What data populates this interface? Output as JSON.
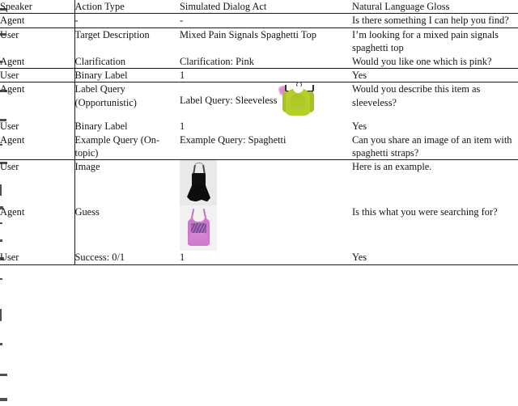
{
  "table": {
    "columns": [
      {
        "key": "speaker",
        "label": "Speaker"
      },
      {
        "key": "action",
        "label": "Action Type"
      },
      {
        "key": "dialog",
        "label": "Simulated Dialog Act"
      },
      {
        "key": "gloss",
        "label": "Natural Language Gloss"
      }
    ],
    "rows": [
      {
        "speaker": "Agent",
        "action": "-",
        "dialog": "-",
        "gloss": "Is there something I can help you find?",
        "media": null,
        "rule_above": false
      },
      {
        "speaker": "User",
        "action": "Target Description",
        "dialog": "Mixed Pain Signals Spaghetti Top",
        "gloss": "I’m looking for a mixed pain signals spaghetti top",
        "media": null,
        "rule_above": true
      },
      {
        "speaker": "Agent",
        "action": "Clarification",
        "dialog": "Clarification: Pink",
        "gloss": "Would you like one which is pink?",
        "media": null,
        "rule_above": false
      },
      {
        "speaker": "User",
        "action": "Binary Label",
        "dialog": "1",
        "gloss": "Yes",
        "media": null,
        "rule_above": true
      },
      {
        "speaker": "Agent",
        "action": "Label Query (Opportunistic)",
        "dialog": "Label Query: Sleeveless",
        "gloss": "Would you describe this item as sleeveless?",
        "media": "green-sleeveless-top-thumbnail",
        "rule_above": true
      },
      {
        "speaker": "User",
        "action": "Binary Label",
        "dialog": "1",
        "gloss": "Yes",
        "media": null,
        "rule_above": false
      },
      {
        "speaker": "Agent",
        "action": "Example Query (On-topic)",
        "dialog": "Example Query: Spaghetti",
        "gloss": "Can you share an image of an item with spaghetti straps?",
        "media": null,
        "rule_above": false
      },
      {
        "speaker": "User",
        "action": "Image",
        "dialog": "",
        "gloss": "Here is an example.",
        "media": "black-spaghetti-strap-dress-thumbnail",
        "rule_above": true
      },
      {
        "speaker": "Agent",
        "action": "Guess",
        "dialog": "",
        "gloss": "Is this what you were searching for?",
        "media": "pink-graphic-tank-top-thumbnail",
        "rule_above": false
      },
      {
        "speaker": "User",
        "action": "Success: 0/1",
        "dialog": "1",
        "gloss": "Yes",
        "media": null,
        "rule_above": false
      }
    ]
  },
  "colors": {
    "rule": "#1a1a1a",
    "text": "#141414",
    "page_background": "#ffffff",
    "green_garment": "#b7cf2b",
    "pink_garment": "#cd79cc",
    "black_garment": "#101010",
    "photo_background": "#e9e9e9"
  }
}
